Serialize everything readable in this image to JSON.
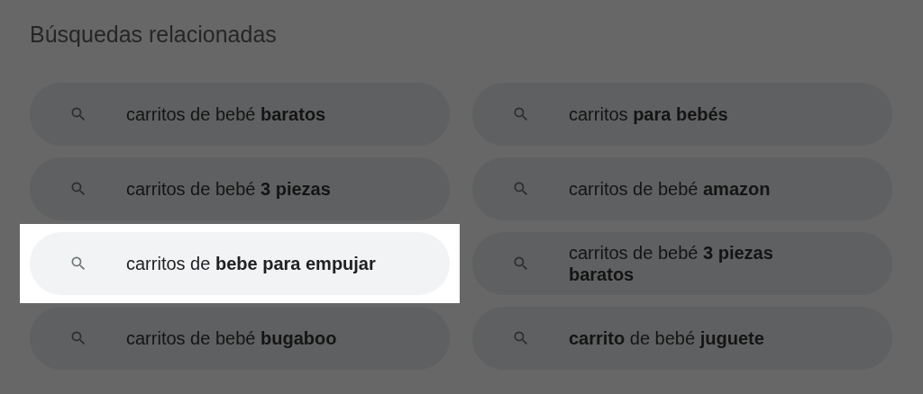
{
  "title": "Búsquedas relacionadas",
  "items": [
    {
      "text": "carritos de bebé **baratos**",
      "highlighted": false
    },
    {
      "text": "carritos **para bebés**",
      "highlighted": false
    },
    {
      "text": "carritos de bebé **3 piezas**",
      "highlighted": false
    },
    {
      "text": "carritos de bebé **amazon**",
      "highlighted": false
    },
    {
      "text": "carritos de **bebe para empujar**",
      "highlighted": true
    },
    {
      "text": "carritos de bebé **3 piezas baratos**",
      "highlighted": false
    },
    {
      "text": "carritos de bebé **bugaboo**",
      "highlighted": false
    },
    {
      "text": "**carrito** de bebé **juguete**",
      "highlighted": false
    }
  ]
}
